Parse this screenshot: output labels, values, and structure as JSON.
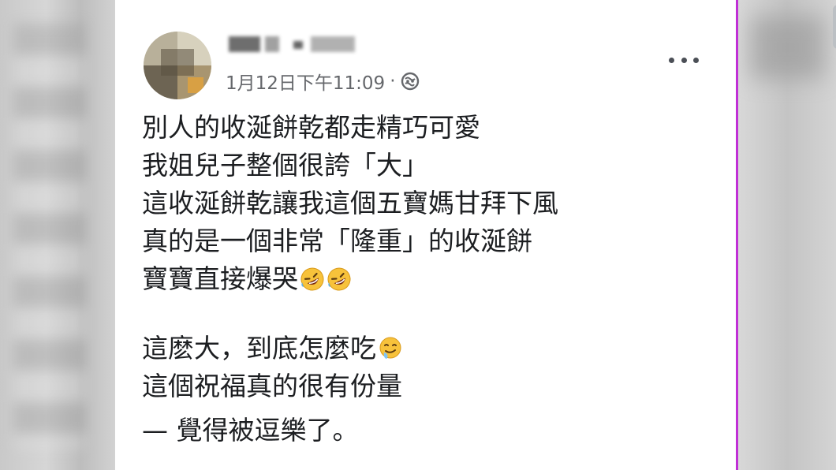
{
  "post": {
    "author_name": "",
    "timestamp": "1月12日下午11:09",
    "separator": "·",
    "audience_icon": "globe-icon",
    "more_icon": "more-options-icon",
    "lines": [
      "別人的收涎餅乾都走精巧可愛",
      "我姐兒子整個很誇「大」",
      "這收涎餅乾讓我這個五寶媽甘拜下風",
      "真的是一個非常「隆重」的收涎餅",
      "寶寶直接爆哭",
      "這麽大，到底怎麼吃",
      "這個祝福真的很有份量",
      "— 覺得被逗樂了。"
    ],
    "emoji": {
      "rofl": "rolling-on-floor-laughing-emoji",
      "drool": "drooling-face-emoji"
    }
  },
  "colors": {
    "card_bg": "#ffffff",
    "text": "#1c1e21",
    "meta_text": "#65676b",
    "frame_accent": "#c02fd6",
    "emoji_yellow": "#f7c23b"
  }
}
